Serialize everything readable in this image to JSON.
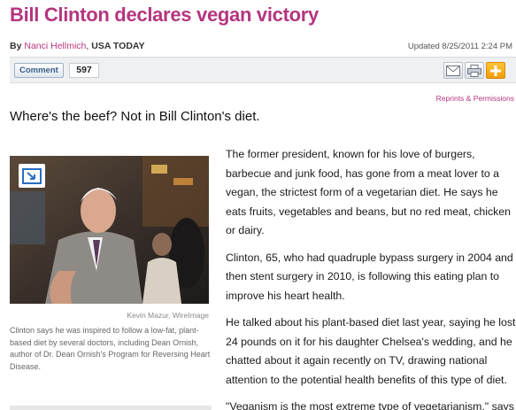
{
  "article": {
    "headline": "Bill Clinton declares vegan victory",
    "byline": {
      "by": "By",
      "author": "Nanci Hellmich",
      "separator": ",",
      "source": "USA TODAY"
    },
    "updated": "Updated 8/25/2011 2:24 PM",
    "subhead": "Where's the beef? Not in Bill Clinton's diet.",
    "reprints_label": "Reprints & Permissions",
    "paragraphs": [
      "The former president, known for his love of burgers, barbecue and junk food, has gone from a meat lover to a vegan, the strictest form of a vegetarian diet. He says he eats fruits, vegetables and beans, but no red meat, chicken or dairy.",
      "Clinton, 65, who had quadruple bypass surgery in 2004 and then stent surgery in 2010, is following this eating plan to improve his heart health.",
      "He talked about his plant-based diet last year, saying he lost 24 pounds on it for his daughter Chelsea's wedding, and he chatted about it again recently on TV, drawing national attention to the potential health benefits of this type of diet.",
      "\"Veganism is the most extreme type of vegetarianism,\" says"
    ]
  },
  "toolbar": {
    "comment_label": "Comment",
    "comment_count": "597",
    "icons": [
      "email-icon",
      "print-icon",
      "share-plus-icon"
    ]
  },
  "photo": {
    "credit": "Kevin Mazur, WireImage",
    "caption": "Clinton says he was inspired to follow a low-fat, plant-based diet by several doctors, including Dean Ornish, author of Dr. Dean Ornish's Program for Reversing Heart Disease.",
    "expand_icon": "expand-icon"
  },
  "colors": {
    "headline": "#b5357f",
    "link": "#b5357f",
    "accent_plus": "#f29b09"
  }
}
